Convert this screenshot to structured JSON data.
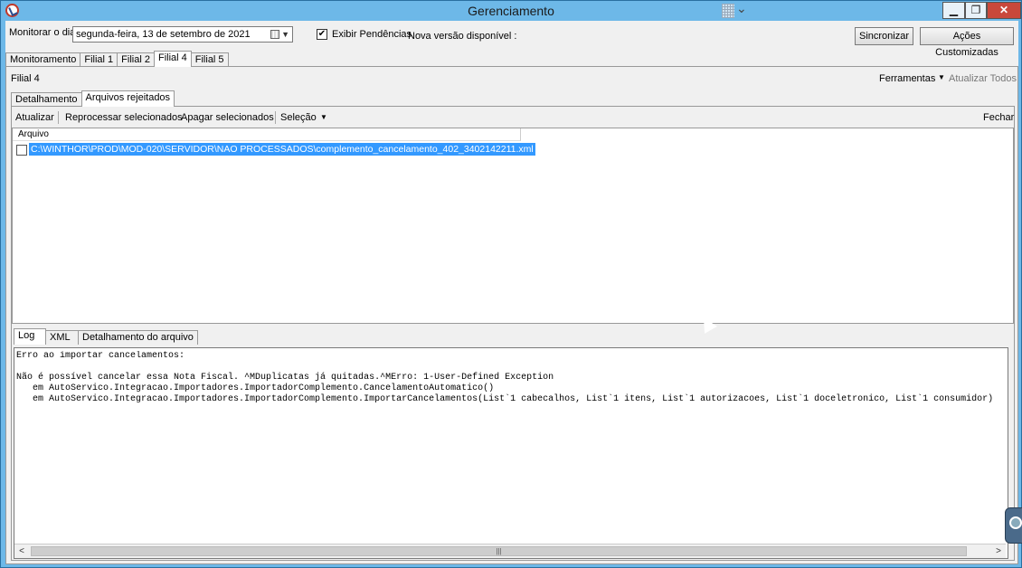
{
  "window": {
    "title": "Gerenciamento",
    "min_label": "▁",
    "max_label": "❐",
    "close_label": "✕"
  },
  "top": {
    "monitor_label": "Monitorar o dia",
    "date_value": "segunda-feira, 13 de setembro  de 2021",
    "show_pending_label": "Exibir Pendências",
    "show_pending_checked": true,
    "new_version_label": "Nova versão disponível :",
    "sync_button": "Sincronizar",
    "custom_actions_button": "Ações Customizadas"
  },
  "main_tabs": [
    {
      "label": "Monitoramento",
      "active": false
    },
    {
      "label": "Filial 1",
      "active": false
    },
    {
      "label": "Filial 2",
      "active": false
    },
    {
      "label": "Filial 4",
      "active": true
    },
    {
      "label": "Filial 5",
      "active": false
    }
  ],
  "panel": {
    "title": "Filial 4",
    "tools_label": "Ferramentas",
    "update_all_label": "Atualizar Todos"
  },
  "sub_tabs": [
    {
      "label": "Detalhamento",
      "active": false
    },
    {
      "label": "Arquivos rejeitados",
      "active": true
    }
  ],
  "toolbar": {
    "update": "Atualizar",
    "reprocess": "Reprocessar selecionados",
    "delete": "Apagar selecionados",
    "selection": "Seleção",
    "close": "Fechar"
  },
  "file_list": {
    "column_header": "Arquivo",
    "rows": [
      {
        "path": "C:\\WINTHOR\\PROD\\MOD-020\\SERVIDOR\\NAO PROCESSADOS\\complemento_cancelamento_402_3402142211.xml",
        "selected": true,
        "checked": false
      }
    ]
  },
  "bottom_tabs": [
    {
      "label": "Log",
      "active": true
    },
    {
      "label": "XML",
      "active": false
    },
    {
      "label": "Detalhamento do arquivo",
      "active": false
    }
  ],
  "log": {
    "lines": [
      "Erro ao importar cancelamentos:",
      "",
      "Não é possível cancelar essa Nota Fiscal. ^MDuplicatas já quitadas.^MErro: 1-User-Defined Exception",
      "   em AutoServico.Integracao.Importadores.ImportadorComplemento.CancelamentoAutomatico()",
      "   em AutoServico.Integracao.Importadores.ImportadorComplemento.ImportarCancelamentos(List`1 cabecalhos, List`1 itens, List`1 autorizacoes, List`1 doceletronico, List`1 consumidor)"
    ]
  },
  "scrollbar": {
    "left_arrow": "<",
    "right_arrow": ">",
    "thumb_grip": "|||"
  }
}
